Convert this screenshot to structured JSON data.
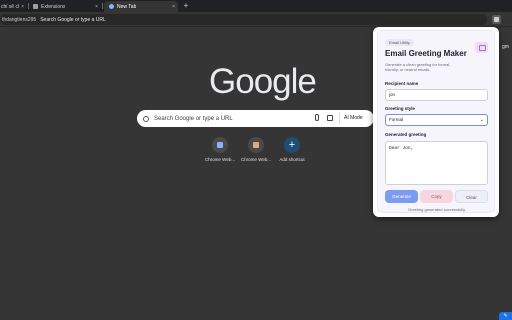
{
  "tabs": [
    {
      "label": "chỉ sẽ cl",
      "close": "×"
    },
    {
      "label": "Extensions",
      "close": "×"
    },
    {
      "label": "New Tab",
      "close": "×"
    }
  ],
  "new_tab_symbol": "+",
  "omnibox": {
    "prefix": "thdangtiens295",
    "placeholder": "Search Google or type a URL"
  },
  "profile_fragment": "",
  "side_fragment": "gm",
  "google_logo": "Google",
  "search": {
    "placeholder": "Search Google or type a URL",
    "ai_mode": "AI Mode"
  },
  "shortcuts": [
    {
      "label": "Chrome Web..."
    },
    {
      "label": "Chrome Web..."
    },
    {
      "label": "Add shortcut",
      "symbol": "+"
    }
  ],
  "popup": {
    "badge": "Email Utility",
    "title": "Email Greeting Maker",
    "description": "Generate a clean greeting for formal, friendly, or neutral emails.",
    "recipient_label": "Recipient name",
    "recipient_value": "jon",
    "style_label": "Greeting style",
    "style_value": "Formal",
    "generated_label": "Generated greeting",
    "generated_value": "Dear Jon,",
    "buttons": {
      "generate": "Generate",
      "copy": "Copy",
      "clear": "Clear"
    },
    "status": "Greeting generated successfully."
  },
  "colors": {
    "accent": "#7b9cf0",
    "copy_button": "#f7d6df",
    "page_bg": "#353535"
  },
  "corner_icon": "pencil-icon"
}
